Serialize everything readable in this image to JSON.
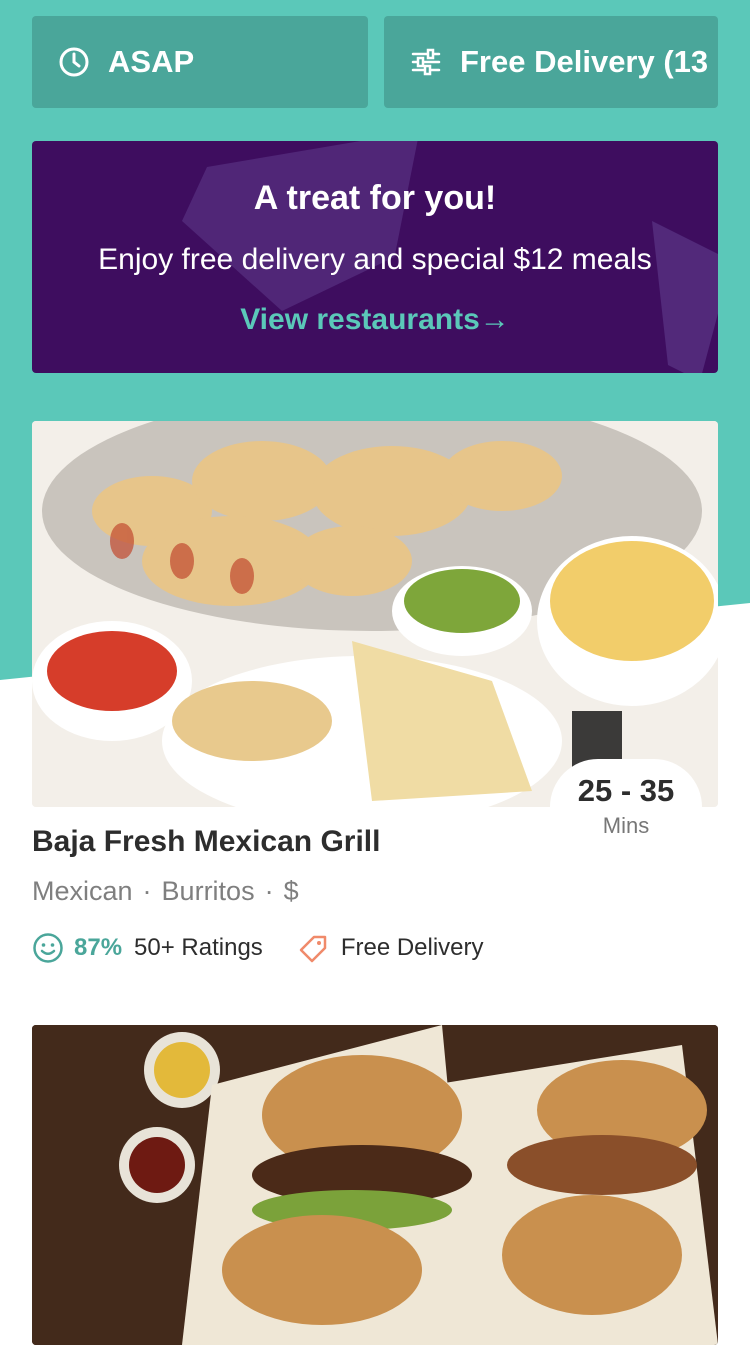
{
  "filters": {
    "asap_label": "ASAP",
    "delivery_label": "Free Delivery (13"
  },
  "promo": {
    "title": "A treat for you!",
    "subtitle": "Enjoy free delivery and special $12 meals",
    "link_label": "View restaurants",
    "link_arrow": "→"
  },
  "restaurants": [
    {
      "name": "Baja Fresh Mexican Grill",
      "tags": [
        "Mexican",
        "Burritos",
        "$"
      ],
      "eta_range": "25 - 35",
      "eta_unit": "Mins",
      "rating_percent": "87%",
      "ratings_count": "50+ Ratings",
      "delivery_label": "Free Delivery"
    }
  ],
  "colors": {
    "teal": "#5bc8b9",
    "teal_dark": "#4aa69a",
    "promo_purple": "#3e0d5f",
    "text_dark": "#2d2d2d",
    "text_gray": "#7f7f7f",
    "tag_orange": "#f08a6a"
  }
}
